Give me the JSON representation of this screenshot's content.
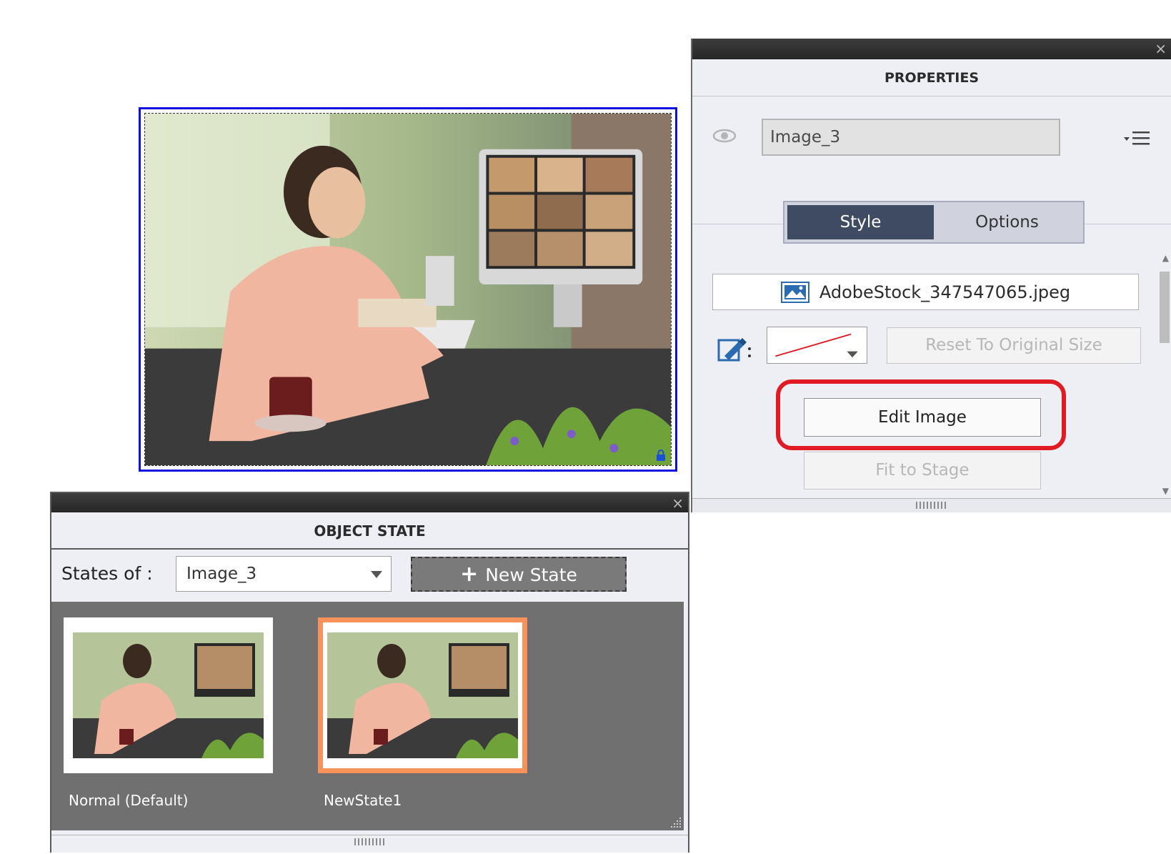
{
  "stage": {
    "image_name": "Image_3",
    "selection_color": "#1010e0"
  },
  "properties": {
    "title": "PROPERTIES",
    "close_label": "×",
    "object_name": "Image_3",
    "icons": {
      "visibility": "eye-icon",
      "menu": "panel-menu-icon",
      "file": "image-file-icon",
      "eyedropper": "eyedropper-icon"
    },
    "tabs": [
      {
        "label": "Style",
        "active": true
      },
      {
        "label": "Options",
        "active": false
      }
    ],
    "file_name": "AdobeStock_347547065.jpeg",
    "reset_label": "Reset To Original Size",
    "edit_label": "Edit Image",
    "fit_label": "Fit to Stage",
    "highlight_color": "#e01b24",
    "active_tab_color": "#3f4a63"
  },
  "object_state": {
    "title": "OBJECT STATE",
    "close_label": "×",
    "states_of_label": "States of :",
    "selected_object": "Image_3",
    "new_state_label": "New State",
    "states": [
      {
        "label": "Normal (Default)",
        "selected": false
      },
      {
        "label": "NewState1",
        "selected": true
      }
    ],
    "selected_border_color": "#f7935a"
  }
}
